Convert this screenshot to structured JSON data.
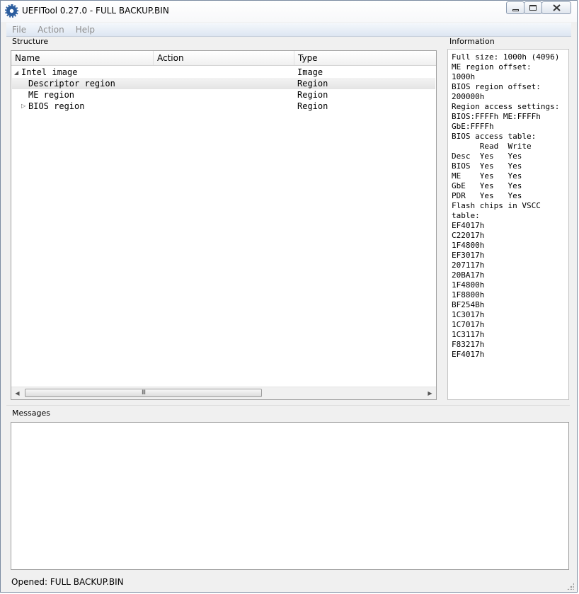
{
  "window": {
    "title": "UEFITool 0.27.0 - FULL BACKUP.BIN"
  },
  "menu": {
    "file": "File",
    "action": "Action",
    "help": "Help"
  },
  "structure": {
    "label": "Structure",
    "columns": [
      "Name",
      "Action",
      "Type"
    ],
    "rows": [
      {
        "name": "Intel image",
        "action": "",
        "type": "Image",
        "expander": "expanded"
      },
      {
        "name": "Descriptor region",
        "action": "",
        "type": "Region",
        "selected": true
      },
      {
        "name": "ME region",
        "action": "",
        "type": "Region"
      },
      {
        "name": "BIOS region",
        "action": "",
        "type": "Region",
        "expander": "collapsed"
      }
    ],
    "scrollbar_thumb_glyph": "III"
  },
  "information": {
    "label": "Information",
    "lines": [
      "Full size: 1000h (4096)",
      "ME region offset:",
      "1000h",
      "BIOS region offset:",
      "200000h",
      "Region access settings:",
      "BIOS:FFFFh ME:FFFFh",
      "GbE:FFFFh",
      "BIOS access table:",
      "      Read  Write",
      "Desc  Yes   Yes",
      "BIOS  Yes   Yes",
      "ME    Yes   Yes",
      "GbE   Yes   Yes",
      "PDR   Yes   Yes",
      "Flash chips in VSCC",
      "table:",
      "EF4017h",
      "C22017h",
      "1F4800h",
      "EF3017h",
      "207117h",
      "20BA17h",
      "1F4800h",
      "1F8800h",
      "BF254Bh",
      "1C3017h",
      "1C7017h",
      "1C3117h",
      "F83217h",
      "EF4017h"
    ]
  },
  "messages": {
    "label": "Messages"
  },
  "status": {
    "text": "Opened: FULL BACKUP.BIN"
  }
}
